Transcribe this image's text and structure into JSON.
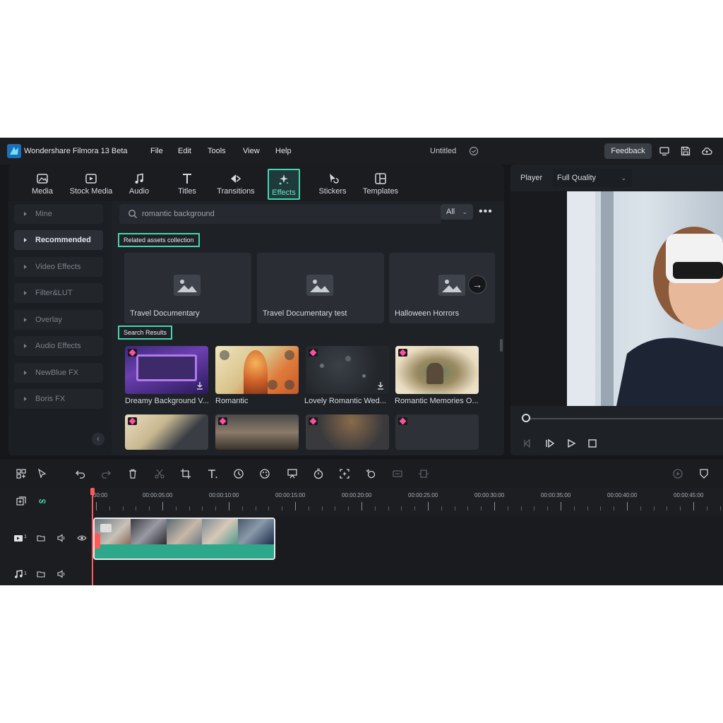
{
  "titlebar": {
    "app_title": "Wondershare Filmora 13 Beta",
    "menu": [
      "File",
      "Edit",
      "Tools",
      "View",
      "Help"
    ],
    "doc_title": "Untitled",
    "feedback": "Feedback"
  },
  "tabs": [
    {
      "label": "Media",
      "icon": "media-icon"
    },
    {
      "label": "Stock Media",
      "icon": "stock-media-icon"
    },
    {
      "label": "Audio",
      "icon": "audio-note-icon"
    },
    {
      "label": "Titles",
      "icon": "titles-t-icon"
    },
    {
      "label": "Transitions",
      "icon": "transitions-icon"
    },
    {
      "label": "Effects",
      "icon": "effects-sparkle-icon",
      "active": true
    },
    {
      "label": "Stickers",
      "icon": "stickers-icon"
    },
    {
      "label": "Templates",
      "icon": "templates-icon"
    }
  ],
  "sidebar": {
    "items": [
      {
        "label": "Mine"
      },
      {
        "label": "Recommended",
        "active": true
      },
      {
        "label": "Video Effects"
      },
      {
        "label": "Filter&LUT"
      },
      {
        "label": "Overlay"
      },
      {
        "label": "Audio Effects"
      },
      {
        "label": "NewBlue FX"
      },
      {
        "label": "Boris FX"
      }
    ]
  },
  "search": {
    "value": "romantic background",
    "filter": "All"
  },
  "related": {
    "label": "Related assets collection",
    "items": [
      "Travel Documentary",
      "Travel Documentary test",
      "Halloween Horrors"
    ]
  },
  "results": {
    "label": "Search Results",
    "items": [
      "Dreamy Background V...",
      "Romantic",
      "Lovely Romantic Wed...",
      "Romantic Memories O..."
    ]
  },
  "player": {
    "label": "Player",
    "quality": "Full Quality"
  },
  "timeline": {
    "timecodes": [
      "00:00",
      "00:00:05:00",
      "00:00:10:00",
      "00:00:15:00",
      "00:00:20:00",
      "00:00:25:00",
      "00:00:30:00",
      "00:00:35:00",
      "00:00:40:00",
      "00:00:45:00"
    ],
    "video_track": "1",
    "audio_track": "1"
  },
  "colors": {
    "accent": "#45d6b0",
    "clip": "#2ea88a",
    "playhead": "#ff5a5a",
    "premium_gem": "#ff4fa3"
  }
}
